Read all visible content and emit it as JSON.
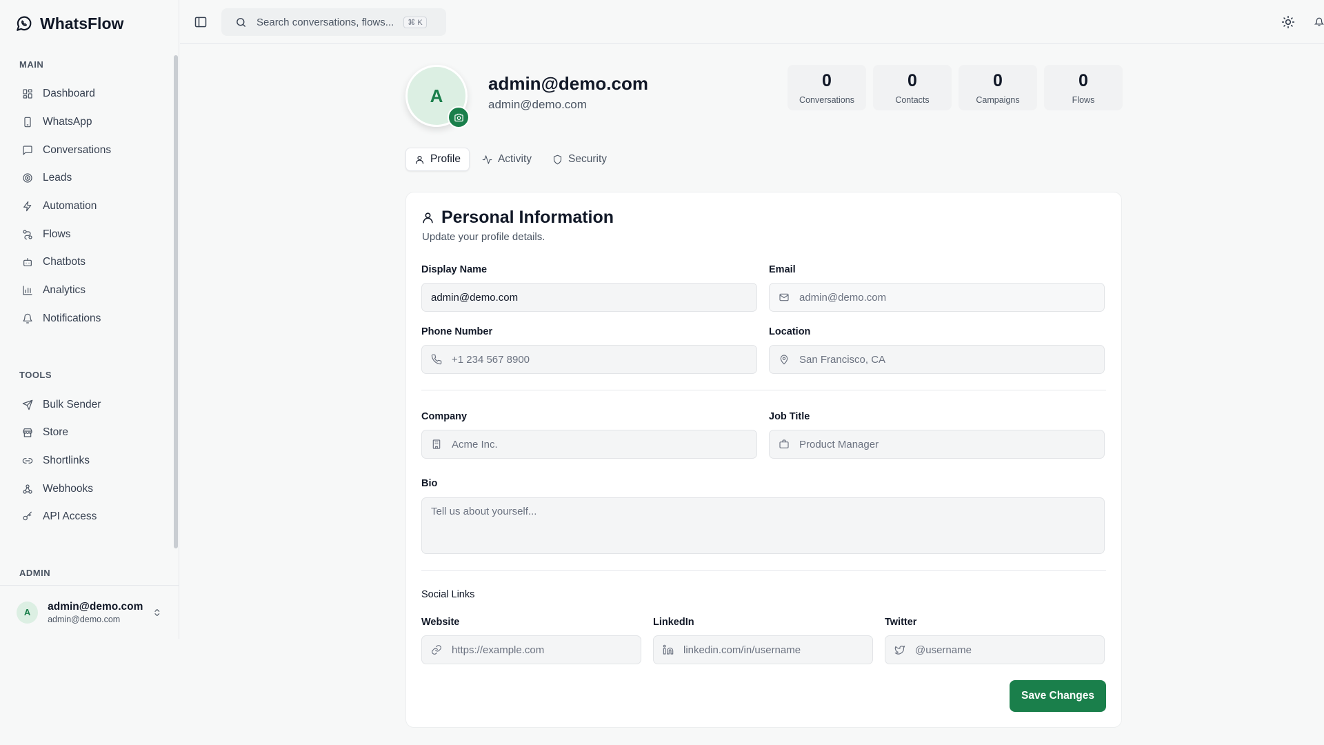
{
  "app": {
    "name": "WhatsFlow"
  },
  "sidebar": {
    "sections": [
      {
        "label": "MAIN",
        "items": [
          {
            "label": "Dashboard",
            "icon": "dashboard-icon"
          },
          {
            "label": "WhatsApp",
            "icon": "phone-icon"
          },
          {
            "label": "Conversations",
            "icon": "message-icon"
          },
          {
            "label": "Leads",
            "icon": "target-icon"
          },
          {
            "label": "Automation",
            "icon": "zap-icon"
          },
          {
            "label": "Flows",
            "icon": "workflow-icon"
          },
          {
            "label": "Chatbots",
            "icon": "bot-icon"
          },
          {
            "label": "Analytics",
            "icon": "bar-chart-icon"
          },
          {
            "label": "Notifications",
            "icon": "bell-icon"
          }
        ]
      },
      {
        "label": "TOOLS",
        "items": [
          {
            "label": "Bulk Sender",
            "icon": "send-icon"
          },
          {
            "label": "Store",
            "icon": "store-icon"
          },
          {
            "label": "Shortlinks",
            "icon": "link-icon"
          },
          {
            "label": "Webhooks",
            "icon": "webhook-icon"
          },
          {
            "label": "API Access",
            "icon": "key-icon"
          }
        ]
      },
      {
        "label": "ADMIN",
        "items": []
      }
    ],
    "user": {
      "initial": "A",
      "name": "admin@demo.com",
      "email": "admin@demo.com"
    }
  },
  "topbar": {
    "search_placeholder": "Search conversations, flows...",
    "shortcut": "⌘ K"
  },
  "profile": {
    "initial": "A",
    "name": "admin@demo.com",
    "email": "admin@demo.com",
    "stats": [
      {
        "value": "0",
        "label": "Conversations"
      },
      {
        "value": "0",
        "label": "Contacts"
      },
      {
        "value": "0",
        "label": "Campaigns"
      },
      {
        "value": "0",
        "label": "Flows"
      }
    ]
  },
  "tabs": [
    {
      "label": "Profile",
      "active": true
    },
    {
      "label": "Activity",
      "active": false
    },
    {
      "label": "Security",
      "active": false
    }
  ],
  "form": {
    "title": "Personal Information",
    "subtitle": "Update your profile details.",
    "display_name": {
      "label": "Display Name",
      "value": "admin@demo.com"
    },
    "email": {
      "label": "Email",
      "value": "admin@demo.com"
    },
    "phone": {
      "label": "Phone Number",
      "placeholder": "+1 234 567 8900"
    },
    "location": {
      "label": "Location",
      "placeholder": "San Francisco, CA"
    },
    "company": {
      "label": "Company",
      "placeholder": "Acme Inc."
    },
    "job_title": {
      "label": "Job Title",
      "placeholder": "Product Manager"
    },
    "bio": {
      "label": "Bio",
      "placeholder": "Tell us about yourself..."
    },
    "social_heading": "Social Links",
    "website": {
      "label": "Website",
      "placeholder": "https://example.com"
    },
    "linkedin": {
      "label": "LinkedIn",
      "placeholder": "linkedin.com/in/username"
    },
    "twitter": {
      "label": "Twitter",
      "placeholder": "@username"
    },
    "save_label": "Save Changes"
  },
  "colors": {
    "accent": "#1a7f4b",
    "avatar_bg": "#dcefe3"
  }
}
